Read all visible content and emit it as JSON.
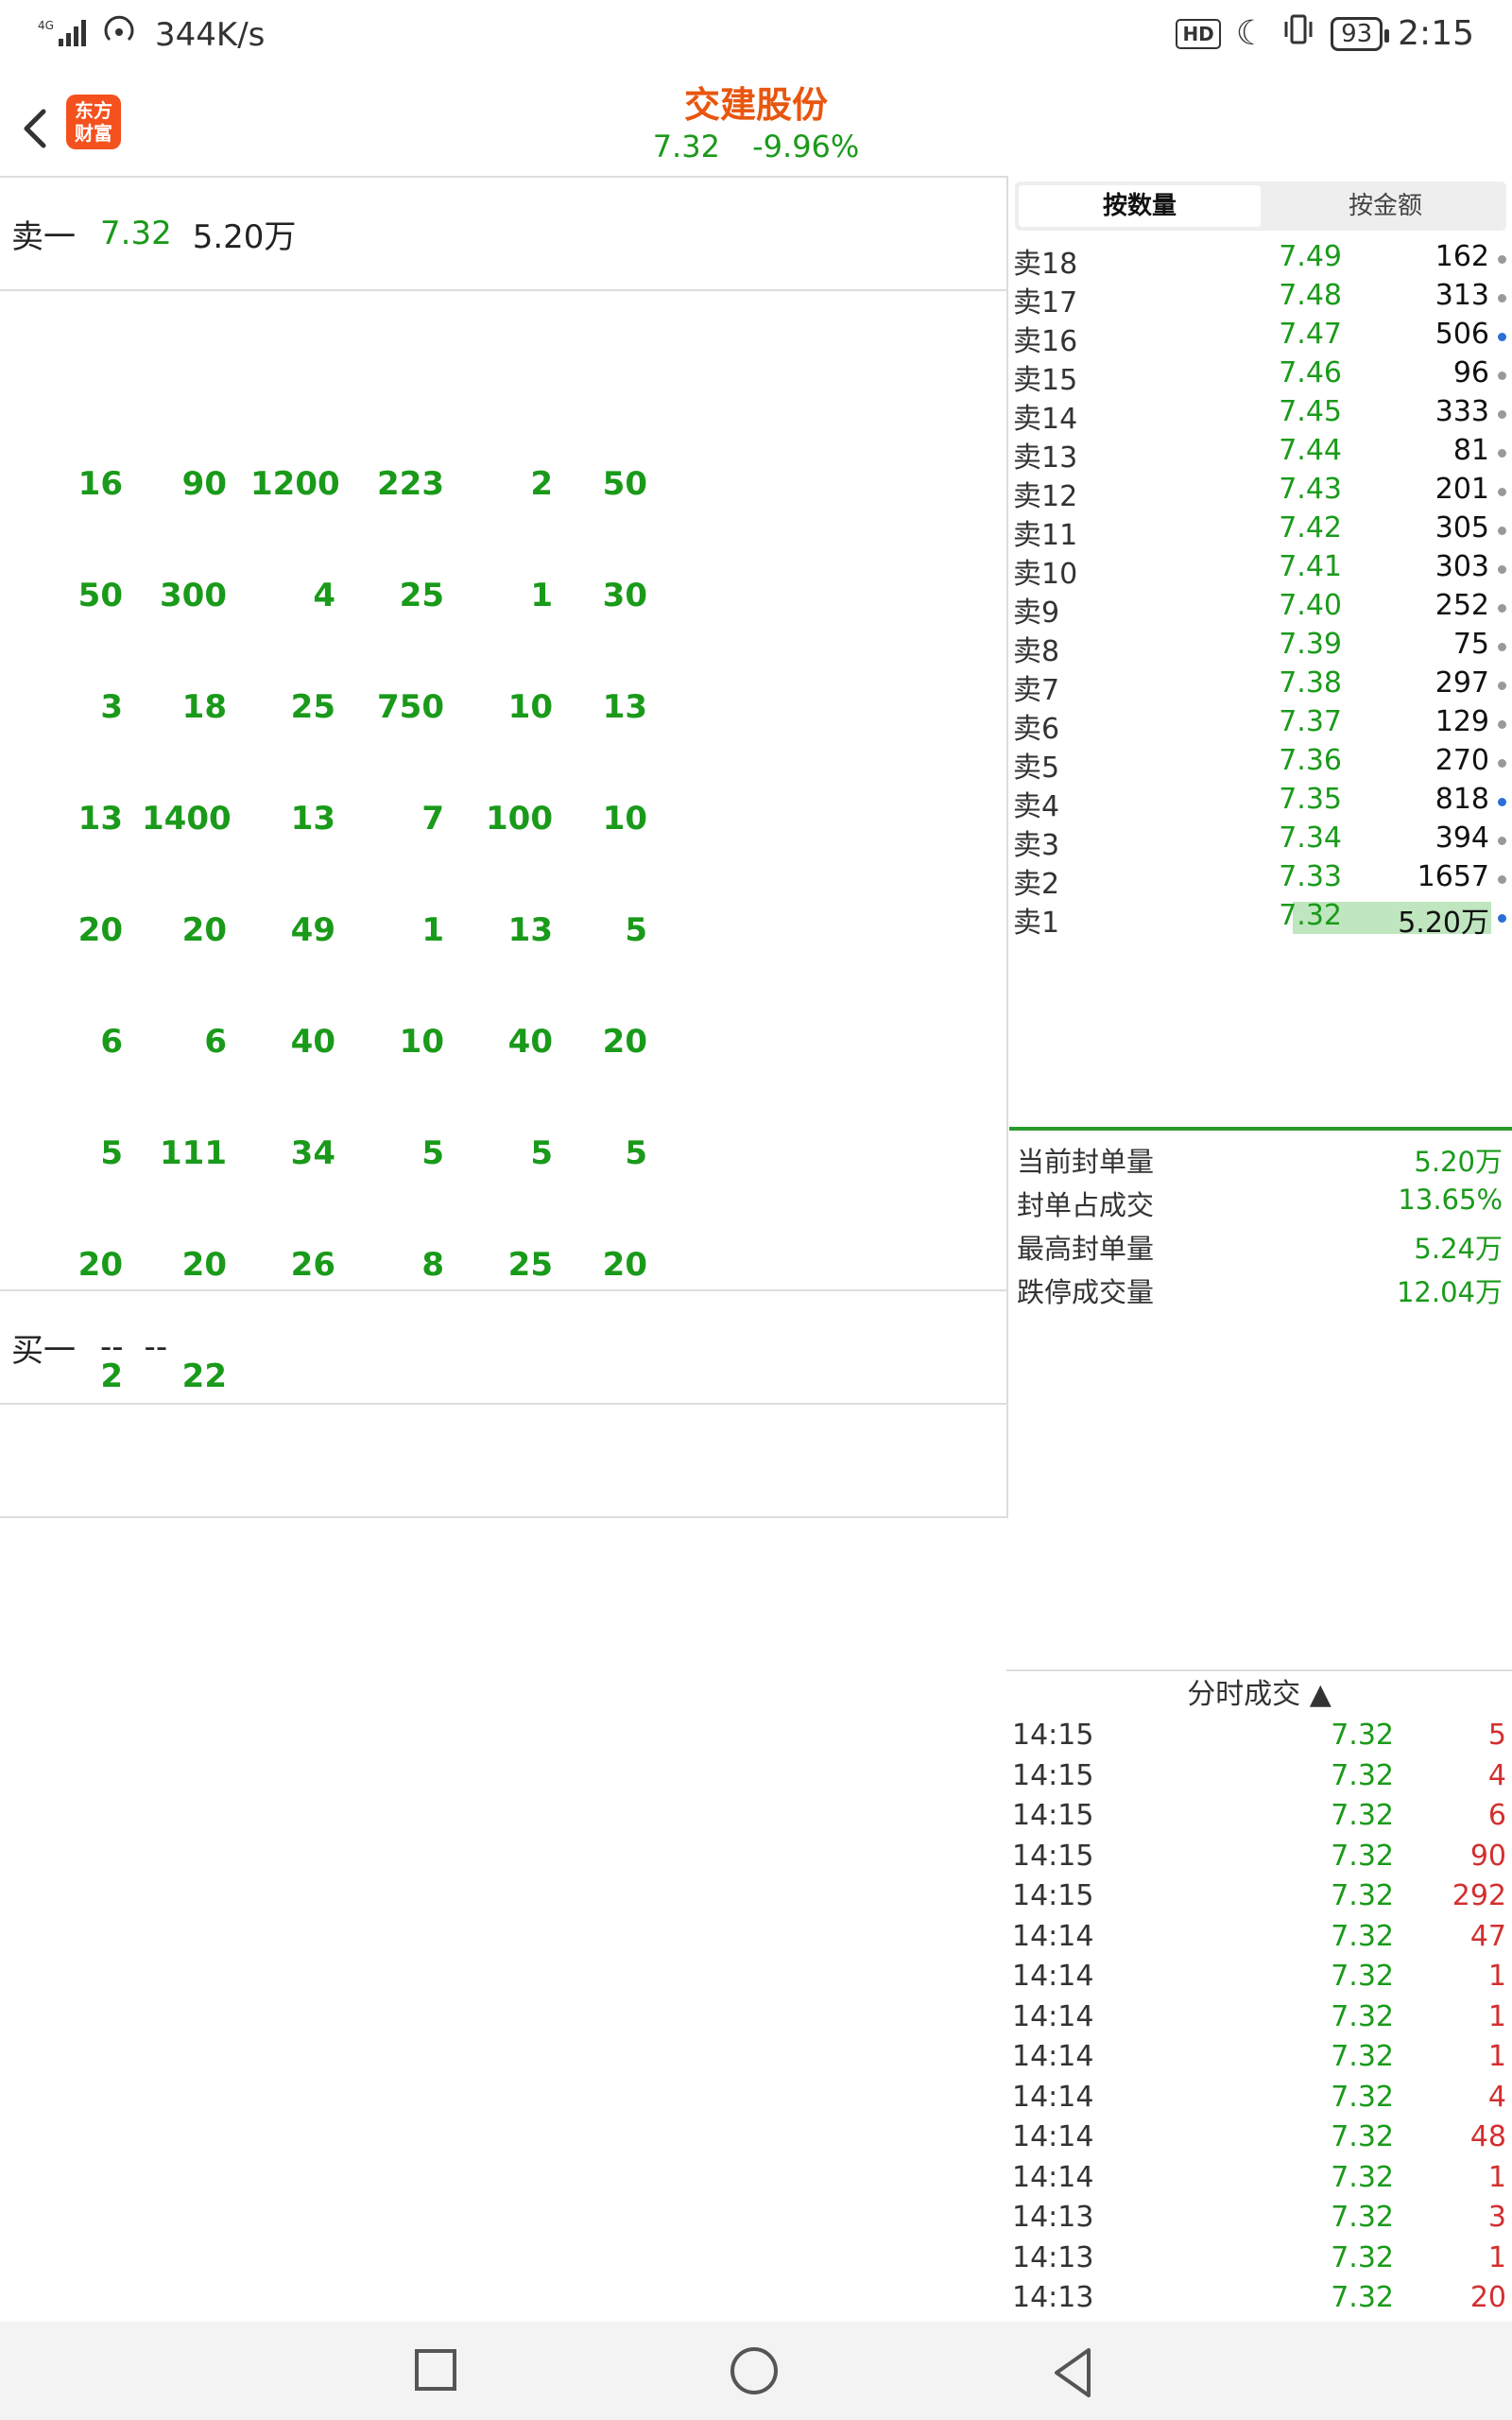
{
  "status": {
    "net": "4G",
    "speed": "344K/s",
    "hd": "HD",
    "battery": "93",
    "time": "2:15"
  },
  "header": {
    "logo_line1": "东方",
    "logo_line2": "财富",
    "title": "交建股份",
    "price": "7.32",
    "change": "-9.96%"
  },
  "left": {
    "sell1": {
      "label": "卖一",
      "price": "7.32",
      "volume": "5.20万"
    },
    "grid": [
      [
        "16",
        "90",
        "1200",
        "223",
        "2",
        "50"
      ],
      [
        "50",
        "300",
        "4",
        "25",
        "1",
        "30"
      ],
      [
        "3",
        "18",
        "25",
        "750",
        "10",
        "13"
      ],
      [
        "13",
        "1400",
        "13",
        "7",
        "100",
        "10"
      ],
      [
        "20",
        "20",
        "49",
        "1",
        "13",
        "5"
      ],
      [
        "6",
        "6",
        "40",
        "10",
        "40",
        "20"
      ],
      [
        "5",
        "111",
        "34",
        "5",
        "5",
        "5"
      ],
      [
        "20",
        "20",
        "26",
        "8",
        "25",
        "20"
      ],
      [
        "2",
        "22",
        "",
        "",
        "",
        ""
      ]
    ],
    "buy1": {
      "label": "买一",
      "price": "--",
      "volume": "--"
    }
  },
  "right": {
    "tabs": [
      {
        "label": "按数量",
        "active": true
      },
      {
        "label": "按金额",
        "active": false
      }
    ],
    "book": [
      {
        "label": "卖18",
        "price": "7.49",
        "vol": "162",
        "dot": "gray"
      },
      {
        "label": "卖17",
        "price": "7.48",
        "vol": "313",
        "dot": "gray"
      },
      {
        "label": "卖16",
        "price": "7.47",
        "vol": "506",
        "dot": "blue"
      },
      {
        "label": "卖15",
        "price": "7.46",
        "vol": "96",
        "dot": "gray"
      },
      {
        "label": "卖14",
        "price": "7.45",
        "vol": "333",
        "dot": "gray"
      },
      {
        "label": "卖13",
        "price": "7.44",
        "vol": "81",
        "dot": "gray"
      },
      {
        "label": "卖12",
        "price": "7.43",
        "vol": "201",
        "dot": "gray"
      },
      {
        "label": "卖11",
        "price": "7.42",
        "vol": "305",
        "dot": "gray"
      },
      {
        "label": "卖10",
        "price": "7.41",
        "vol": "303",
        "dot": "gray"
      },
      {
        "label": "卖9",
        "price": "7.40",
        "vol": "252",
        "dot": "gray"
      },
      {
        "label": "卖8",
        "price": "7.39",
        "vol": "75",
        "dot": "gray"
      },
      {
        "label": "卖7",
        "price": "7.38",
        "vol": "297",
        "dot": "gray"
      },
      {
        "label": "卖6",
        "price": "7.37",
        "vol": "129",
        "dot": "gray"
      },
      {
        "label": "卖5",
        "price": "7.36",
        "vol": "270",
        "dot": "gray"
      },
      {
        "label": "卖4",
        "price": "7.35",
        "vol": "818",
        "dot": "blue"
      },
      {
        "label": "卖3",
        "price": "7.34",
        "vol": "394",
        "dot": "gray"
      },
      {
        "label": "卖2",
        "price": "7.33",
        "vol": "1657",
        "dot": "gray"
      },
      {
        "label": "卖1",
        "price": "7.32",
        "vol": "5.20万",
        "dot": "blue",
        "highlight": true
      }
    ],
    "stats": [
      {
        "k": "当前封单量",
        "v": "5.20万"
      },
      {
        "k": "封单占成交",
        "v": "13.65%"
      },
      {
        "k": "最高封单量",
        "v": "5.24万"
      },
      {
        "k": "跌停成交量",
        "v": "12.04万"
      }
    ],
    "trades_header": "分时成交 ▲",
    "trades": [
      {
        "t": "14:15",
        "p": "7.32",
        "q": "5"
      },
      {
        "t": "14:15",
        "p": "7.32",
        "q": "4"
      },
      {
        "t": "14:15",
        "p": "7.32",
        "q": "6"
      },
      {
        "t": "14:15",
        "p": "7.32",
        "q": "90"
      },
      {
        "t": "14:15",
        "p": "7.32",
        "q": "292"
      },
      {
        "t": "14:14",
        "p": "7.32",
        "q": "47"
      },
      {
        "t": "14:14",
        "p": "7.32",
        "q": "1"
      },
      {
        "t": "14:14",
        "p": "7.32",
        "q": "1"
      },
      {
        "t": "14:14",
        "p": "7.32",
        "q": "1"
      },
      {
        "t": "14:14",
        "p": "7.32",
        "q": "4"
      },
      {
        "t": "14:14",
        "p": "7.32",
        "q": "48"
      },
      {
        "t": "14:14",
        "p": "7.32",
        "q": "1"
      },
      {
        "t": "14:13",
        "p": "7.32",
        "q": "3"
      },
      {
        "t": "14:13",
        "p": "7.32",
        "q": "1"
      },
      {
        "t": "14:13",
        "p": "7.32",
        "q": "20"
      }
    ]
  }
}
